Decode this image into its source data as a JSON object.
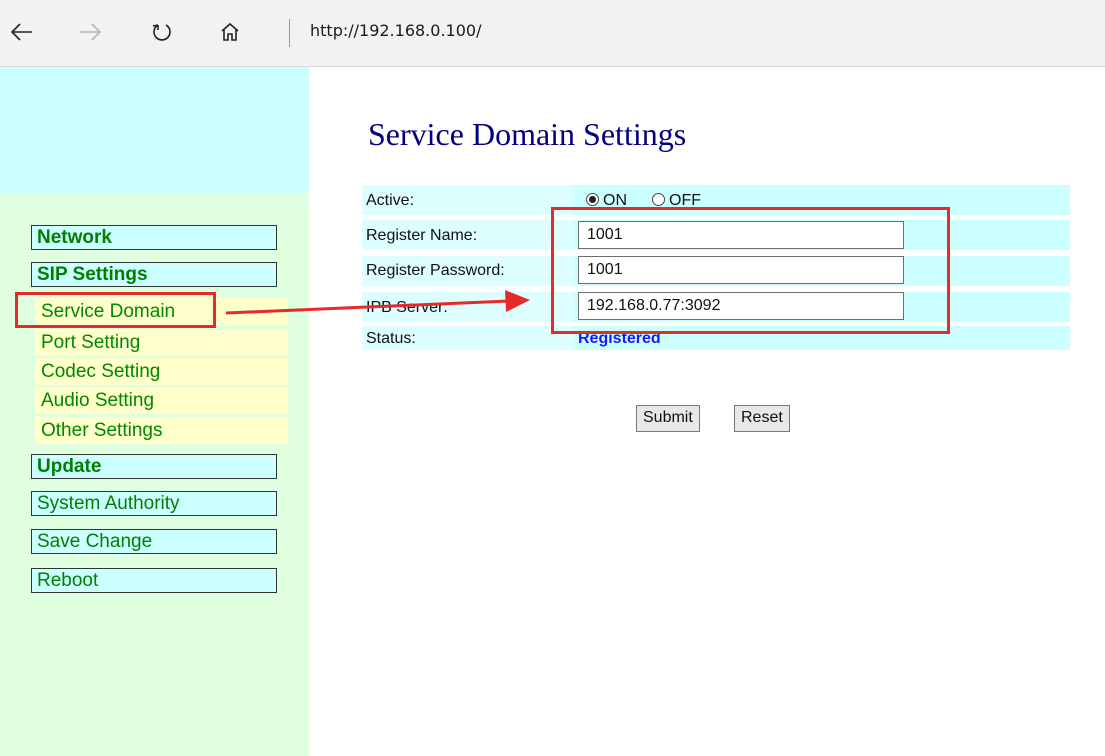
{
  "browser": {
    "url": "http://192.168.0.100/",
    "back_icon": "back-arrow-icon",
    "forward_icon": "forward-arrow-icon",
    "refresh_icon": "refresh-icon",
    "home_icon": "home-icon"
  },
  "sidebar": {
    "network": "Network",
    "sip_settings": "SIP Settings",
    "sub_items": [
      "Service Domain",
      "Port Setting",
      "Codec Setting",
      "Audio Setting",
      "Other Settings"
    ],
    "update": "Update",
    "system_authority": "System Authority",
    "save_change": "Save Change",
    "reboot": "Reboot"
  },
  "main": {
    "title": "Service Domain Settings",
    "fields": {
      "active_label": "Active:",
      "active_on": "ON",
      "active_off": "OFF",
      "active_value": "ON",
      "register_name_label": "Register Name:",
      "register_name_value": "1001",
      "register_password_label": "Register Password:",
      "register_password_value": "1001",
      "ipb_server_label": "IPB Server:",
      "ipb_server_value": "192.168.0.77:3092",
      "status_label": "Status:",
      "status_value": "Registered"
    },
    "submit_label": "Submit",
    "reset_label": "Reset"
  },
  "colors": {
    "annotation": "#e52a2a",
    "menu_text": "#007f00",
    "title": "#000080",
    "status": "#1a1aff"
  }
}
